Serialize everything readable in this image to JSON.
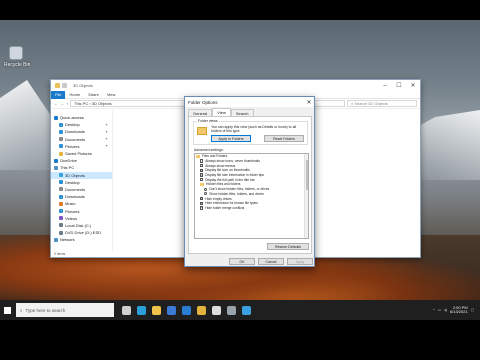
{
  "desktop": {
    "icons": [
      {
        "label": "Recycle Bin",
        "icon": "recycle-bin-icon"
      }
    ]
  },
  "explorer": {
    "title": "3D Objects",
    "ribbon_tabs": [
      "File",
      "Home",
      "Share",
      "View"
    ],
    "breadcrumb": [
      "This PC",
      "3D Objects"
    ],
    "search_placeholder": "Search 3D Objects",
    "nav_items": [
      {
        "label": "Quick access",
        "icon": "star-icon",
        "color": "#1979ca",
        "selected": false,
        "pinned": false
      },
      {
        "label": "Desktop",
        "icon": "desktop-icon",
        "color": "#2d8fd5",
        "selected": false,
        "pinned": true
      },
      {
        "label": "Downloads",
        "icon": "download-icon",
        "color": "#2d8fd5",
        "selected": false,
        "pinned": true
      },
      {
        "label": "Documents",
        "icon": "document-icon",
        "color": "#8a8a8a",
        "selected": false,
        "pinned": true
      },
      {
        "label": "Pictures",
        "icon": "picture-icon",
        "color": "#2d8fd5",
        "selected": false,
        "pinned": true
      },
      {
        "label": "Saved Pictures",
        "icon": "folder-icon",
        "color": "#e8b53c",
        "selected": false,
        "pinned": false
      },
      {
        "label": "OneDrive",
        "icon": "cloud-icon",
        "color": "#1979ca",
        "selected": false,
        "pinned": false
      },
      {
        "label": "This PC",
        "icon": "computer-icon",
        "color": "#4a90c8",
        "selected": false,
        "pinned": false
      },
      {
        "label": "3D Objects",
        "icon": "cube-icon",
        "color": "#3aa0e0",
        "selected": true,
        "pinned": false
      },
      {
        "label": "Desktop",
        "icon": "desktop-icon",
        "color": "#2d8fd5",
        "selected": false,
        "pinned": false
      },
      {
        "label": "Documents",
        "icon": "document-icon",
        "color": "#8a8a8a",
        "selected": false,
        "pinned": false
      },
      {
        "label": "Downloads",
        "icon": "download-icon",
        "color": "#2d8fd5",
        "selected": false,
        "pinned": false
      },
      {
        "label": "Music",
        "icon": "music-icon",
        "color": "#e07b2a",
        "selected": false,
        "pinned": false
      },
      {
        "label": "Pictures",
        "icon": "picture-icon",
        "color": "#2d8fd5",
        "selected": false,
        "pinned": false
      },
      {
        "label": "Videos",
        "icon": "video-icon",
        "color": "#7b57c4",
        "selected": false,
        "pinned": false
      },
      {
        "label": "Local Disk (C:)",
        "icon": "disk-icon",
        "color": "#6d7b88",
        "selected": false,
        "pinned": false
      },
      {
        "label": "DVD Drive (D:) ESD",
        "icon": "dvd-icon",
        "color": "#6d7b88",
        "selected": false,
        "pinned": false
      },
      {
        "label": "Network",
        "icon": "network-icon",
        "color": "#4a90c8",
        "selected": false,
        "pinned": false
      }
    ],
    "status": "0 items"
  },
  "dialog": {
    "title": "Folder Options",
    "tabs": [
      "General",
      "View",
      "Search"
    ],
    "active_tab": "View",
    "folder_views_label": "Folder views",
    "folder_views_text": "You can apply this view (such as Details or Icons) to all folders of this type.",
    "apply_button": "Apply to Folders",
    "reset_button": "Reset Folders",
    "advanced_label": "Advanced settings:",
    "advanced_items": [
      {
        "type": "folder",
        "label": "Files and Folders",
        "indent": 0
      },
      {
        "type": "check",
        "label": "Always show icons, never thumbnails",
        "checked": false,
        "indent": 1
      },
      {
        "type": "check",
        "label": "Always show menus",
        "checked": false,
        "indent": 1
      },
      {
        "type": "check",
        "label": "Display file icon on thumbnails",
        "checked": true,
        "indent": 1
      },
      {
        "type": "check",
        "label": "Display file size information in folder tips",
        "checked": true,
        "indent": 1
      },
      {
        "type": "check",
        "label": "Display the full path in the title bar",
        "checked": false,
        "indent": 1
      },
      {
        "type": "folder",
        "label": "Hidden files and folders",
        "indent": 1
      },
      {
        "type": "radio",
        "label": "Don't show hidden files, folders, or drives",
        "checked": true,
        "indent": 2
      },
      {
        "type": "radio",
        "label": "Show hidden files, folders, and drives",
        "checked": false,
        "indent": 2
      },
      {
        "type": "check",
        "label": "Hide empty drives",
        "checked": true,
        "indent": 1
      },
      {
        "type": "check",
        "label": "Hide extensions for known file types",
        "checked": true,
        "indent": 1
      },
      {
        "type": "check",
        "label": "Hide folder merge conflicts",
        "checked": true,
        "indent": 1
      }
    ],
    "restore_button": "Restore Defaults",
    "ok_button": "OK",
    "cancel_button": "Cancel",
    "applyb_button": "Apply"
  },
  "taskbar": {
    "search_placeholder": "Type here to search",
    "pinned": [
      {
        "icon": "task-view-icon",
        "color": "#cfcfcf"
      },
      {
        "icon": "edge-icon",
        "color": "#2aa0d8"
      },
      {
        "icon": "file-explorer-icon",
        "color": "#f0c24b"
      },
      {
        "icon": "store-icon",
        "color": "#3b7bd6"
      },
      {
        "icon": "mail-icon",
        "color": "#2b7cd3"
      },
      {
        "icon": "chrome-icon",
        "color": "#e3b33b"
      },
      {
        "icon": "camera-icon",
        "color": "#dddddd"
      },
      {
        "icon": "settings-icon",
        "color": "#9aa4ad"
      },
      {
        "icon": "photos-icon",
        "color": "#3aa0e0"
      }
    ],
    "time": "2:00 PM",
    "date": "6/13/2021"
  }
}
